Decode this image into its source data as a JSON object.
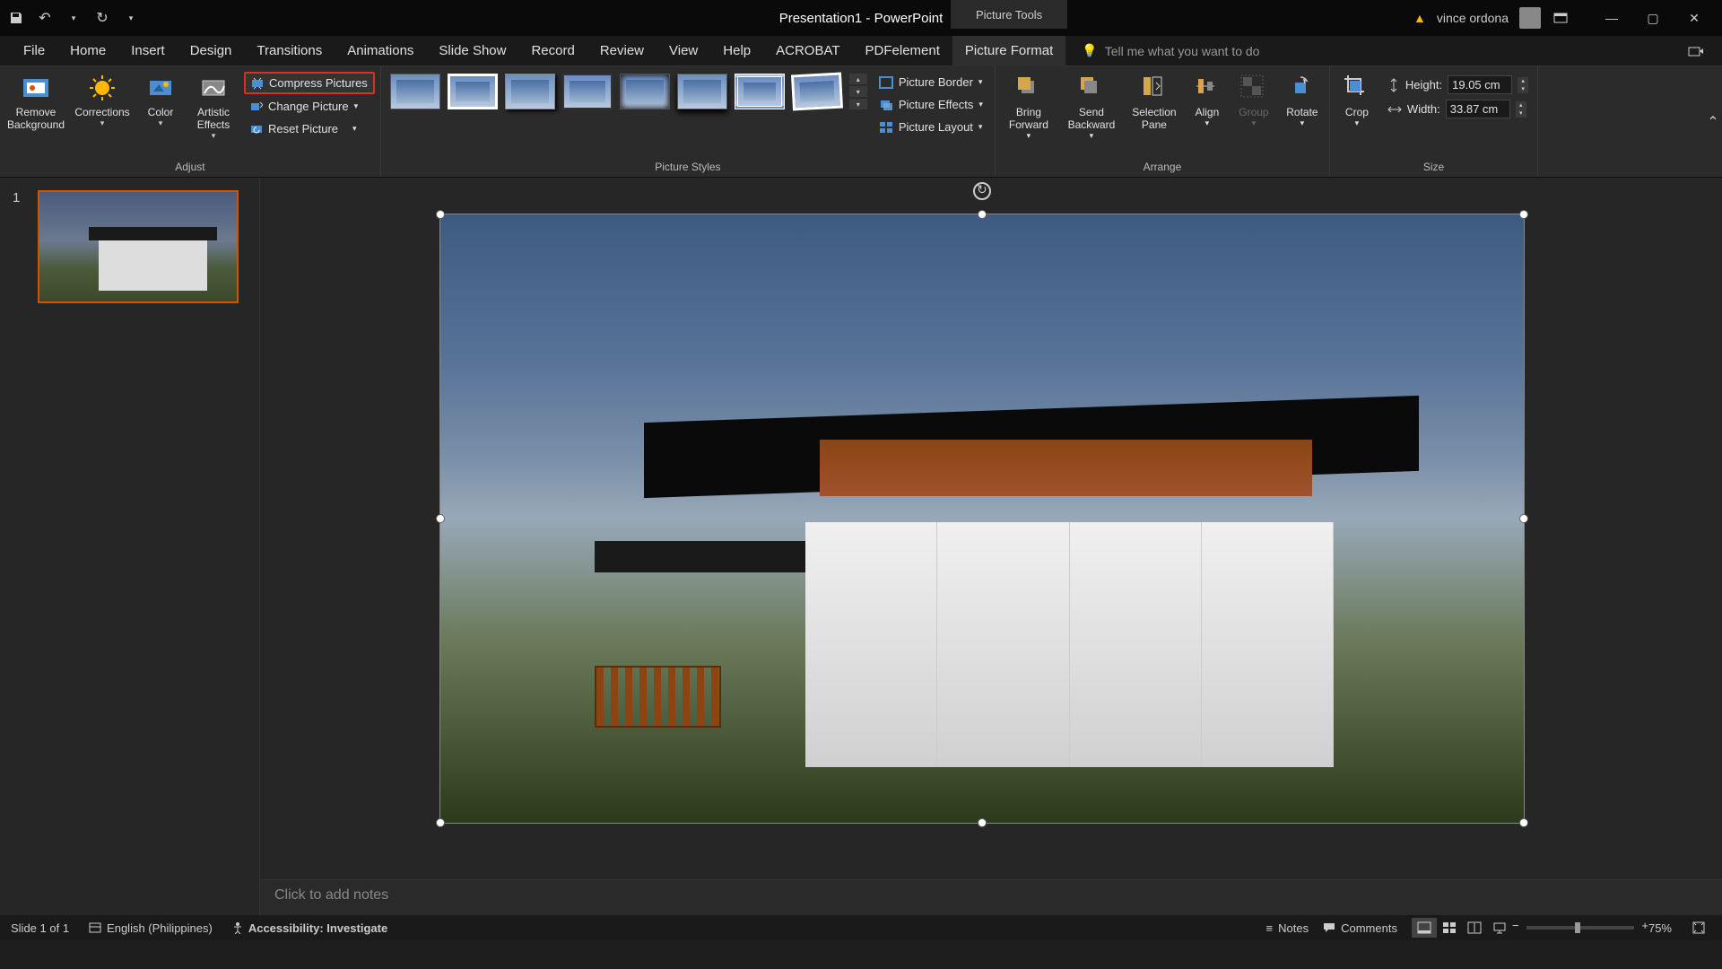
{
  "title": "Presentation1  -  PowerPoint",
  "context_tab": "Picture Tools",
  "user": "vince ordona",
  "tabs": [
    "File",
    "Home",
    "Insert",
    "Design",
    "Transitions",
    "Animations",
    "Slide Show",
    "Record",
    "Review",
    "View",
    "Help",
    "ACROBAT",
    "PDFelement",
    "Picture Format"
  ],
  "active_tab": 13,
  "tellme_placeholder": "Tell me what you want to do",
  "ribbon": {
    "adjust": {
      "remove_bg": "Remove\nBackground",
      "corrections": "Corrections",
      "color": "Color",
      "artistic": "Artistic\nEffects",
      "compress": "Compress Pictures",
      "change": "Change Picture",
      "reset": "Reset Picture",
      "label": "Adjust"
    },
    "styles_label": "Picture Styles",
    "picture_border": "Picture Border",
    "picture_effects": "Picture Effects",
    "picture_layout": "Picture Layout",
    "arrange": {
      "bring_forward": "Bring\nForward",
      "send_backward": "Send\nBackward",
      "selection_pane": "Selection\nPane",
      "align": "Align",
      "group": "Group",
      "rotate": "Rotate",
      "label": "Arrange"
    },
    "crop": "Crop",
    "size": {
      "height_label": "Height:",
      "height_value": "19.05 cm",
      "width_label": "Width:",
      "width_value": "33.87 cm",
      "label": "Size"
    }
  },
  "slide_thumb_number": "1",
  "notes_placeholder": "Click to add notes",
  "status": {
    "slide": "Slide 1 of 1",
    "lang": "English (Philippines)",
    "access": "Accessibility: Investigate",
    "notes": "Notes",
    "comments": "Comments",
    "zoom": "75%"
  }
}
